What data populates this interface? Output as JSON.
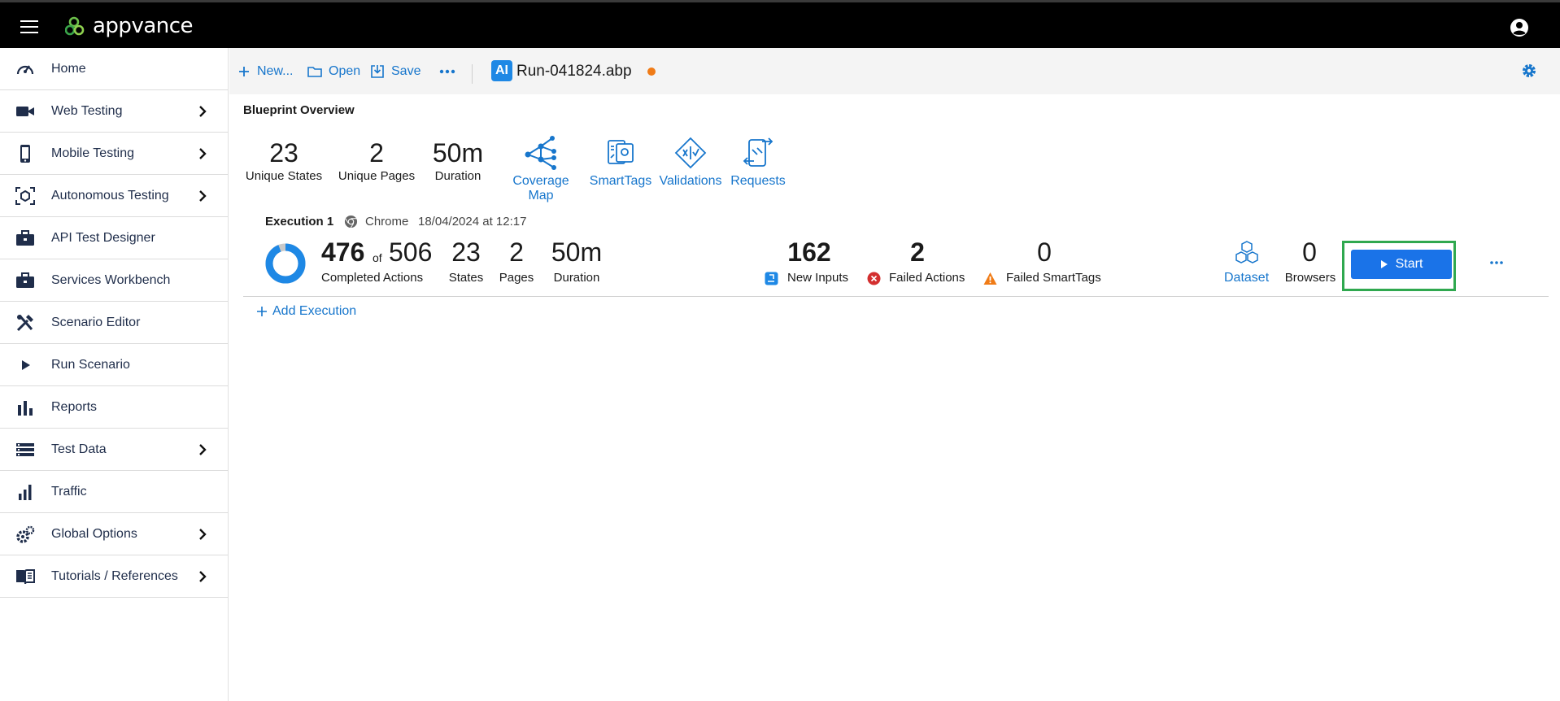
{
  "app": {
    "name": "appvance"
  },
  "sidebar": {
    "items": [
      {
        "label": "Home",
        "icon": "gauge-icon",
        "has_submenu": false
      },
      {
        "label": "Web Testing",
        "icon": "video-camera-icon",
        "has_submenu": true
      },
      {
        "label": "Mobile Testing",
        "icon": "phone-icon",
        "has_submenu": true
      },
      {
        "label": "Autonomous Testing",
        "icon": "cube-scan-icon",
        "has_submenu": true
      },
      {
        "label": "API Test Designer",
        "icon": "briefcase-icon",
        "has_submenu": false
      },
      {
        "label": "Services Workbench",
        "icon": "briefcase-icon",
        "has_submenu": false
      },
      {
        "label": "Scenario Editor",
        "icon": "tools-icon",
        "has_submenu": false
      },
      {
        "label": "Run Scenario",
        "icon": "play-icon",
        "has_submenu": false
      },
      {
        "label": "Reports",
        "icon": "bar-chart-icon",
        "has_submenu": false
      },
      {
        "label": "Test Data",
        "icon": "list-icon",
        "has_submenu": true
      },
      {
        "label": "Traffic",
        "icon": "signal-bars-icon",
        "has_submenu": false
      },
      {
        "label": "Global Options",
        "icon": "gears-icon",
        "has_submenu": true
      },
      {
        "label": "Tutorials / References",
        "icon": "book-icon",
        "has_submenu": true
      }
    ]
  },
  "toolbar": {
    "new_label": "New...",
    "open_label": "Open",
    "save_label": "Save",
    "ai_badge": "AI",
    "file_name": "Run-041824.abp",
    "unsaved_color": "#f07b16"
  },
  "overview": {
    "title": "Blueprint Overview",
    "stats": [
      {
        "value": "23",
        "label": "Unique States"
      },
      {
        "value": "2",
        "label": "Unique Pages"
      },
      {
        "value": "50m",
        "label": "Duration"
      }
    ],
    "links": [
      {
        "label": "Coverage Map",
        "icon": "network-graph-icon"
      },
      {
        "label": "SmartTags",
        "icon": "smarttags-icon"
      },
      {
        "label": "Validations",
        "icon": "validation-diamond-icon"
      },
      {
        "label": "Requests",
        "icon": "phone-request-icon"
      }
    ]
  },
  "execution": {
    "title": "Execution 1",
    "browser": "Chrome",
    "date": "18/04/2024 at 12:17",
    "completed": "476",
    "of_label": "of",
    "total": "506",
    "completed_label": "Completed Actions",
    "completion_ratio": 0.9407,
    "states": "23",
    "states_label": "States",
    "pages": "2",
    "pages_label": "Pages",
    "duration": "50m",
    "duration_label": "Duration",
    "new_inputs": "162",
    "new_inputs_label": "New Inputs",
    "failed_actions": "2",
    "failed_actions_label": "Failed Actions",
    "failed_smarttags": "0",
    "failed_smarttags_label": "Failed SmartTags",
    "dataset_label": "Dataset",
    "browsers": "0",
    "browsers_label": "Browsers",
    "start_label": "Start"
  },
  "add_execution_label": "Add Execution",
  "colors": {
    "accent": "#1776cc",
    "start_button": "#1a73e8",
    "highlight_frame": "#2fa84f",
    "error": "#d32f2f",
    "warning": "#f07b16"
  }
}
